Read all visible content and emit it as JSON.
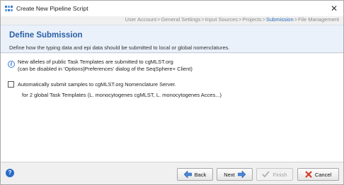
{
  "window": {
    "title": "Create New Pipeline Script",
    "icon": "pipeline-icon",
    "close_label": "✕"
  },
  "breadcrumb": {
    "steps": [
      "User Account",
      "General Settings",
      "Input Sources",
      "Projects",
      "Submission",
      "File Management"
    ],
    "active_index": 4,
    "separator": " > "
  },
  "header": {
    "title": "Define Submission",
    "subtitle": "Define how the typing data and epi data should be submitted to local or global nomenclatures."
  },
  "content": {
    "info_icon": "info-icon",
    "info_line1": "New alleles of public Task Templates are submitted to cgMLST.org",
    "info_line2": "(can be disabled in 'Options|Preferences' dialog of the SeqSphere+ Client)",
    "checkbox_label": "Automatically submit samples to cgMLST.org Nomenclature Server.",
    "checkbox_checked": false,
    "templates_text": "for 2 global Task Templates (L. monocytogenes cgMLST, L. monocytogenes Acces...)"
  },
  "footer": {
    "help_label": "?",
    "back_label": "Back",
    "next_label": "Next",
    "finish_label": "Finish",
    "cancel_label": "Cancel",
    "finish_enabled": false
  },
  "colors": {
    "accent": "#2a5fa5",
    "active_step": "#2a6bbf",
    "header_bg": "#eaf1fa",
    "arrow_blue": "#4a86d6",
    "cancel_red": "#d63a2a"
  }
}
